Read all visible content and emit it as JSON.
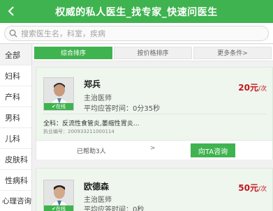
{
  "header": {
    "title": "权威的私人医生_找专家_快速问医生"
  },
  "search": {
    "placeholder": "搜索医生名，科室，疾病"
  },
  "sidebar": {
    "items": [
      {
        "label": "全部"
      },
      {
        "label": "妇科"
      },
      {
        "label": "产科"
      },
      {
        "label": "男科"
      },
      {
        "label": "儿科"
      },
      {
        "label": "皮肤科"
      },
      {
        "label": "性病科"
      },
      {
        "label": "心理咨询"
      }
    ]
  },
  "sort": {
    "tabs": [
      {
        "label": "综合排序"
      },
      {
        "label": "按价格排序"
      },
      {
        "label": "更多条件>"
      }
    ]
  },
  "doctors": [
    {
      "name": "郑兵",
      "title": "主治医师",
      "response_time": "平均应答时间：0分35秒",
      "price": "20元",
      "price_unit": "/次",
      "online": "在线",
      "specialty": "全科：反流性食管炎,萎缩性胃炎...",
      "cert_no": "执业编号：200933211000114",
      "helped": "已帮助3人",
      "arrow": ">",
      "consult_label": "向TA咨询"
    },
    {
      "name": "欧德森",
      "title": "主治医师",
      "response_time": "平均应答时间：0秒",
      "price": "50元",
      "price_unit": "/次",
      "online": "在线"
    }
  ],
  "colors": {
    "brand_green": "#3fb34f",
    "price_red": "#c4161c"
  }
}
